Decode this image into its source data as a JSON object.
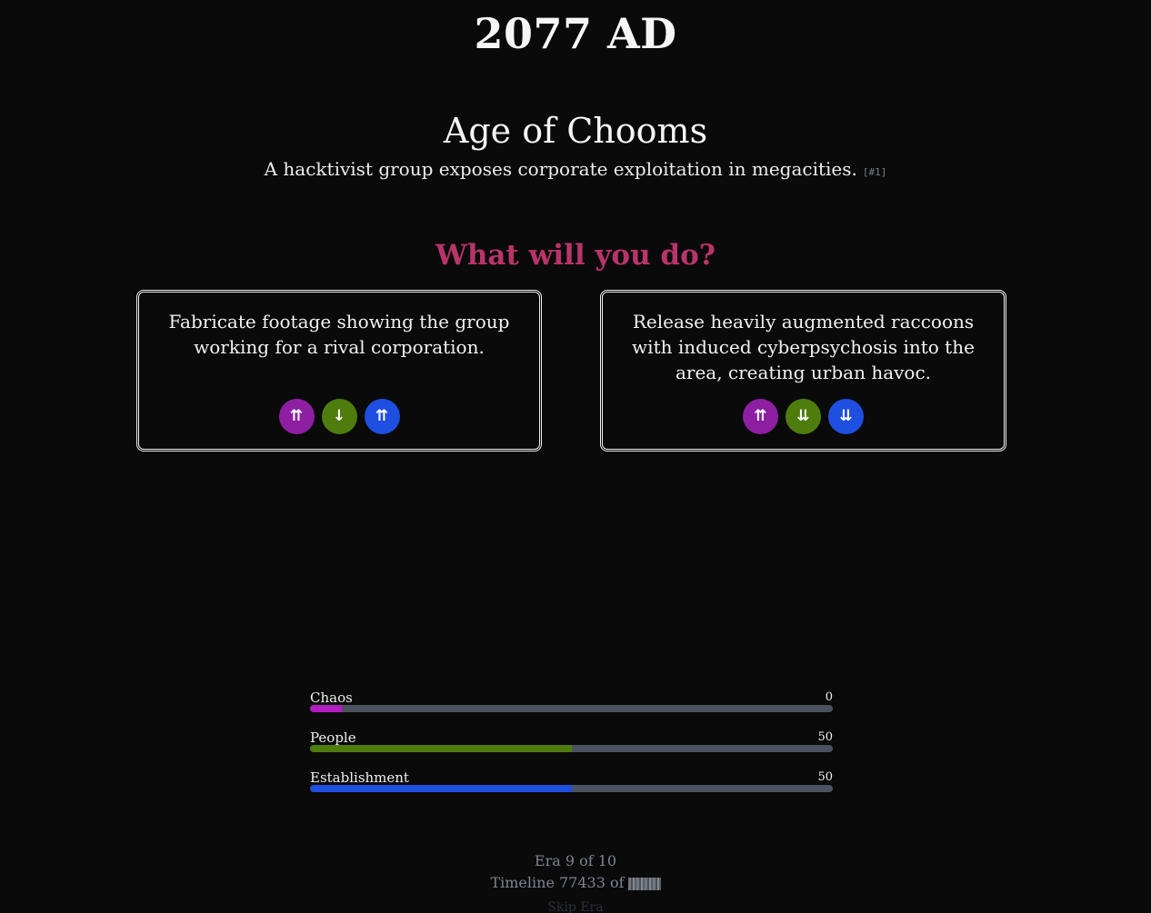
{
  "header": {
    "year": "2077 AD"
  },
  "era": {
    "title": "Age of Chooms",
    "description": "A hacktivist group exposes corporate exploitation in megacities.",
    "ref": "[#1]"
  },
  "prompt": "What will you do?",
  "choices": [
    {
      "text": "Fabricate footage showing the group working for a rival corporation.",
      "effects": [
        {
          "meter": "chaos",
          "symbol": "⇈",
          "icon": "double-up-arrow-icon"
        },
        {
          "meter": "people",
          "symbol": "↓",
          "icon": "down-arrow-icon"
        },
        {
          "meter": "establishment",
          "symbol": "⇈",
          "icon": "double-up-arrow-icon"
        }
      ]
    },
    {
      "text": "Release heavily augmented raccoons with induced cyberpsychosis into the area, creating urban havoc.",
      "effects": [
        {
          "meter": "chaos",
          "symbol": "⇈",
          "icon": "double-up-arrow-icon"
        },
        {
          "meter": "people",
          "symbol": "⇊",
          "icon": "double-down-arrow-icon"
        },
        {
          "meter": "establishment",
          "symbol": "⇊",
          "icon": "double-down-arrow-icon"
        }
      ]
    }
  ],
  "meters": [
    {
      "label": "Chaos",
      "value": "0",
      "fill_fraction": 0.06,
      "color": "#b01dc0"
    },
    {
      "label": "People",
      "value": "50",
      "fill_fraction": 0.5,
      "color": "#4e7d0e"
    },
    {
      "label": "Establishment",
      "value": "50",
      "fill_fraction": 0.5,
      "color": "#1f4fe0"
    }
  ],
  "footer": {
    "era_progress": "Era 9 of 10",
    "timeline": "Timeline 77433 of",
    "skip_label": "Skip Era"
  },
  "colors": {
    "background": "#0a0a0a",
    "prompt": "#b8346a",
    "chaos": "#8e1fa3",
    "people": "#4e7d0e",
    "establishment": "#1f4fe0",
    "track": "#4b5260"
  }
}
